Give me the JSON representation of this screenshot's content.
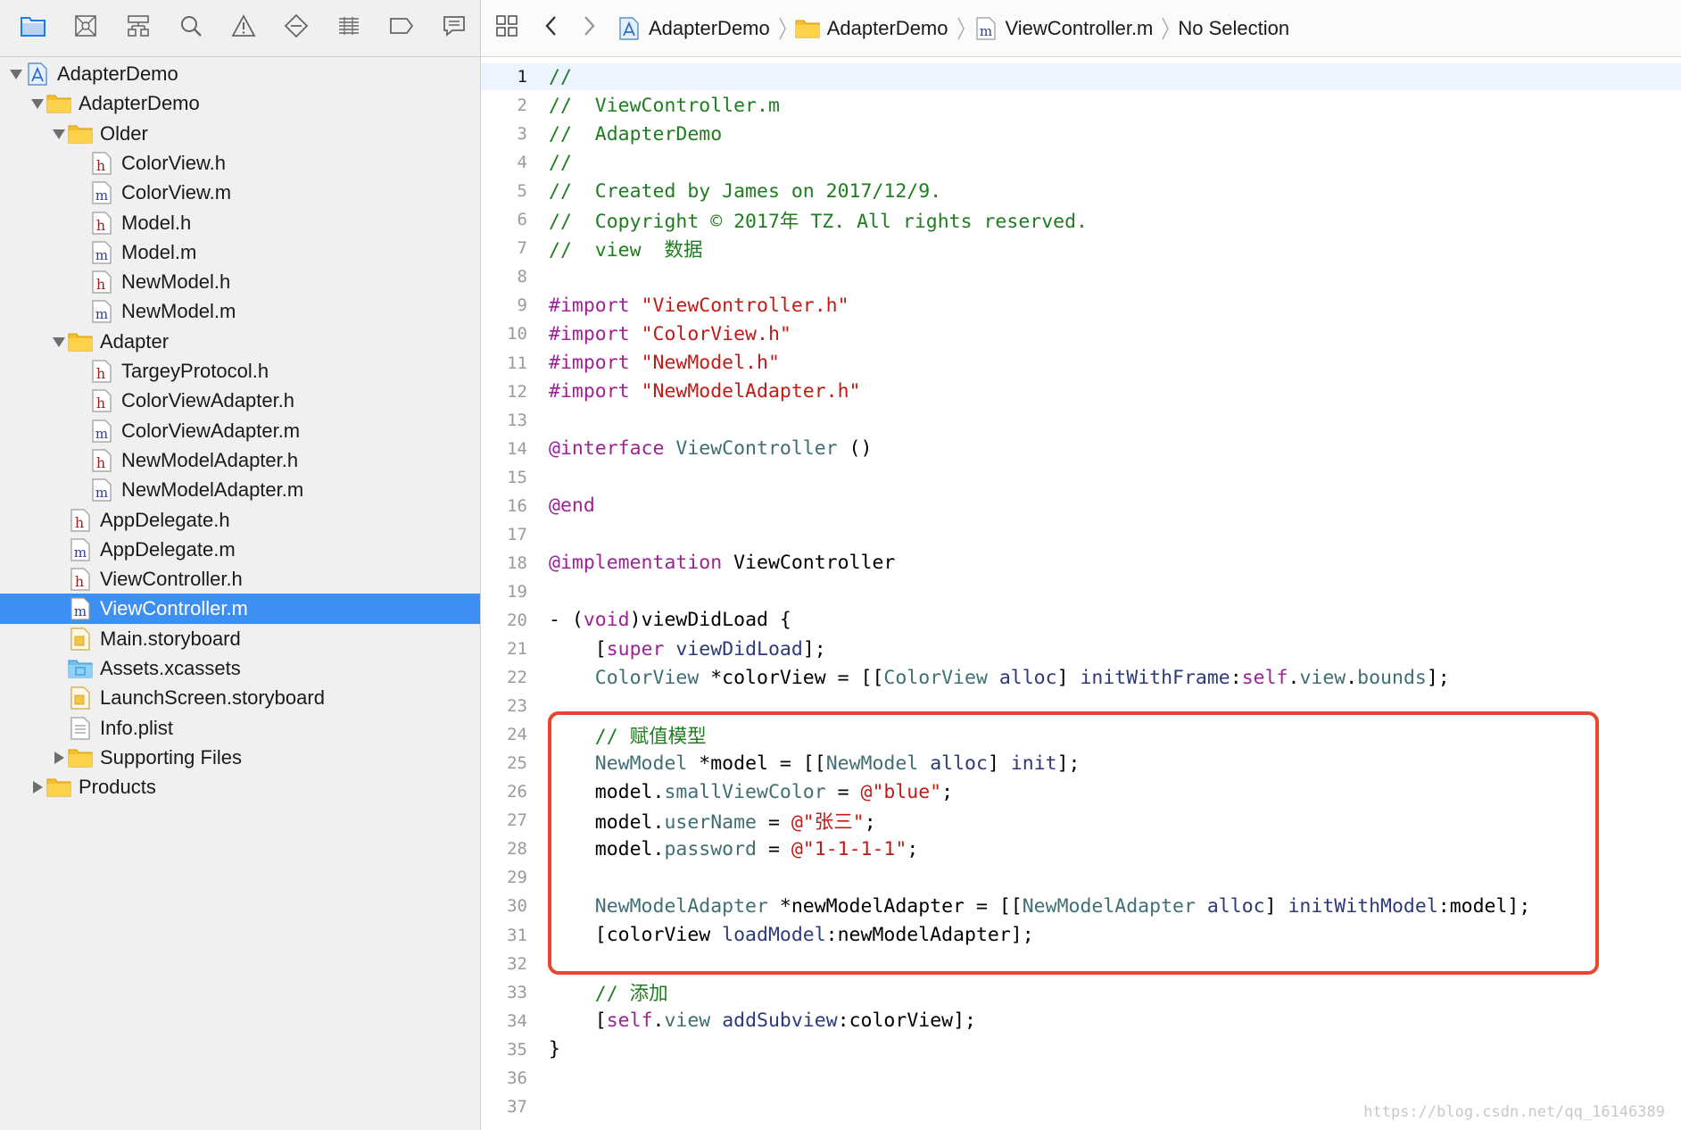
{
  "colors": {
    "selection": "#3d8ff1",
    "highlight_box": "#e8472e",
    "comment": "#1f7d1f",
    "keyword": "#9b2393",
    "string": "#c41a16",
    "type": "#3f6e74",
    "method": "#2c3a7a"
  },
  "navigator_toolbar": [
    {
      "name": "project-navigator-icon",
      "active": true
    },
    {
      "name": "source-control-navigator-icon",
      "active": false
    },
    {
      "name": "symbol-navigator-icon",
      "active": false
    },
    {
      "name": "find-navigator-icon",
      "active": false
    },
    {
      "name": "issue-navigator-icon",
      "active": false
    },
    {
      "name": "test-navigator-icon",
      "active": false
    },
    {
      "name": "debug-navigator-icon",
      "active": false
    },
    {
      "name": "breakpoint-navigator-icon",
      "active": false
    },
    {
      "name": "report-navigator-icon",
      "active": false
    }
  ],
  "tree": [
    {
      "label": "AdapterDemo",
      "depth": 0,
      "icon": "project-icon",
      "disclosure": "open"
    },
    {
      "label": "AdapterDemo",
      "depth": 1,
      "icon": "folder-icon",
      "disclosure": "open"
    },
    {
      "label": "Older",
      "depth": 2,
      "icon": "folder-icon",
      "disclosure": "open"
    },
    {
      "label": "ColorView.h",
      "depth": 3,
      "icon": "h-file-icon",
      "disclosure": "none"
    },
    {
      "label": "ColorView.m",
      "depth": 3,
      "icon": "m-file-icon",
      "disclosure": "none"
    },
    {
      "label": "Model.h",
      "depth": 3,
      "icon": "h-file-icon",
      "disclosure": "none"
    },
    {
      "label": "Model.m",
      "depth": 3,
      "icon": "m-file-icon",
      "disclosure": "none"
    },
    {
      "label": "NewModel.h",
      "depth": 3,
      "icon": "h-file-icon",
      "disclosure": "none"
    },
    {
      "label": "NewModel.m",
      "depth": 3,
      "icon": "m-file-icon",
      "disclosure": "none"
    },
    {
      "label": "Adapter",
      "depth": 2,
      "icon": "folder-icon",
      "disclosure": "open"
    },
    {
      "label": "TargeyProtocol.h",
      "depth": 3,
      "icon": "h-file-icon",
      "disclosure": "none"
    },
    {
      "label": "ColorViewAdapter.h",
      "depth": 3,
      "icon": "h-file-icon",
      "disclosure": "none"
    },
    {
      "label": "ColorViewAdapter.m",
      "depth": 3,
      "icon": "m-file-icon",
      "disclosure": "none"
    },
    {
      "label": "NewModelAdapter.h",
      "depth": 3,
      "icon": "h-file-icon",
      "disclosure": "none"
    },
    {
      "label": "NewModelAdapter.m",
      "depth": 3,
      "icon": "m-file-icon",
      "disclosure": "none"
    },
    {
      "label": "AppDelegate.h",
      "depth": 2,
      "icon": "h-file-icon",
      "disclosure": "none"
    },
    {
      "label": "AppDelegate.m",
      "depth": 2,
      "icon": "m-file-icon",
      "disclosure": "none"
    },
    {
      "label": "ViewController.h",
      "depth": 2,
      "icon": "h-file-icon",
      "disclosure": "none"
    },
    {
      "label": "ViewController.m",
      "depth": 2,
      "icon": "m-file-icon",
      "disclosure": "none",
      "selected": true
    },
    {
      "label": "Main.storyboard",
      "depth": 2,
      "icon": "storyboard-icon",
      "disclosure": "none"
    },
    {
      "label": "Assets.xcassets",
      "depth": 2,
      "icon": "assets-folder-icon",
      "disclosure": "none"
    },
    {
      "label": "LaunchScreen.storyboard",
      "depth": 2,
      "icon": "storyboard-icon",
      "disclosure": "none"
    },
    {
      "label": "Info.plist",
      "depth": 2,
      "icon": "plist-icon",
      "disclosure": "none"
    },
    {
      "label": "Supporting Files",
      "depth": 2,
      "icon": "folder-icon",
      "disclosure": "closed"
    },
    {
      "label": "Products",
      "depth": 1,
      "icon": "folder-icon",
      "disclosure": "closed"
    }
  ],
  "jumpbar": {
    "crumbs": [
      {
        "label": "AdapterDemo",
        "icon": "project-icon"
      },
      {
        "label": "AdapterDemo",
        "icon": "folder-icon"
      },
      {
        "label": "ViewController.m",
        "icon": "m-file-icon"
      },
      {
        "label": "No Selection",
        "icon": ""
      }
    ]
  },
  "code_lines": [
    {
      "n": "1",
      "current": true,
      "tokens": [
        [
          "c",
          "//"
        ]
      ]
    },
    {
      "n": "2",
      "tokens": [
        [
          "c",
          "//  ViewController.m"
        ]
      ]
    },
    {
      "n": "3",
      "tokens": [
        [
          "c",
          "//  AdapterDemo"
        ]
      ]
    },
    {
      "n": "4",
      "tokens": [
        [
          "c",
          "//"
        ]
      ]
    },
    {
      "n": "5",
      "tokens": [
        [
          "c",
          "//  Created by James on 2017/12/9."
        ]
      ]
    },
    {
      "n": "6",
      "tokens": [
        [
          "c",
          "//  Copyright © 2017年 TZ. All rights reserved."
        ]
      ]
    },
    {
      "n": "7",
      "tokens": [
        [
          "c",
          "//  view  数据"
        ]
      ]
    },
    {
      "n": "8",
      "tokens": []
    },
    {
      "n": "9",
      "tokens": [
        [
          "k",
          "#import "
        ],
        [
          "s",
          "\"ViewController.h\""
        ]
      ]
    },
    {
      "n": "10",
      "tokens": [
        [
          "k",
          "#import "
        ],
        [
          "s",
          "\"ColorView.h\""
        ]
      ]
    },
    {
      "n": "11",
      "tokens": [
        [
          "k",
          "#import "
        ],
        [
          "s",
          "\"NewModel.h\""
        ]
      ]
    },
    {
      "n": "12",
      "tokens": [
        [
          "k",
          "#import "
        ],
        [
          "s",
          "\"NewModelAdapter.h\""
        ]
      ]
    },
    {
      "n": "13",
      "tokens": []
    },
    {
      "n": "14",
      "tokens": [
        [
          "k",
          "@interface "
        ],
        [
          "t",
          "ViewController"
        ],
        [
          "p",
          " ()"
        ]
      ]
    },
    {
      "n": "15",
      "tokens": []
    },
    {
      "n": "16",
      "tokens": [
        [
          "k",
          "@end"
        ]
      ]
    },
    {
      "n": "17",
      "tokens": []
    },
    {
      "n": "18",
      "tokens": [
        [
          "k",
          "@implementation "
        ],
        [
          "p",
          "ViewController"
        ]
      ]
    },
    {
      "n": "19",
      "tokens": []
    },
    {
      "n": "20",
      "tokens": [
        [
          "p",
          "- ("
        ],
        [
          "k",
          "void"
        ],
        [
          "p",
          ")viewDidLoad {"
        ]
      ]
    },
    {
      "n": "21",
      "tokens": [
        [
          "p",
          "    ["
        ],
        [
          "k",
          "super"
        ],
        [
          "p",
          " "
        ],
        [
          "m",
          "viewDidLoad"
        ],
        [
          "p",
          "];"
        ]
      ]
    },
    {
      "n": "22",
      "tokens": [
        [
          "p",
          "    "
        ],
        [
          "t",
          "ColorView"
        ],
        [
          "p",
          " *colorView = [["
        ],
        [
          "t",
          "ColorView"
        ],
        [
          "p",
          " "
        ],
        [
          "m",
          "alloc"
        ],
        [
          "p",
          "] "
        ],
        [
          "m",
          "initWithFrame"
        ],
        [
          "p",
          ":"
        ],
        [
          "k",
          "self"
        ],
        [
          "p",
          "."
        ],
        [
          "r",
          "view"
        ],
        [
          "p",
          "."
        ],
        [
          "r",
          "bounds"
        ],
        [
          "p",
          "];"
        ]
      ]
    },
    {
      "n": "23",
      "tokens": []
    },
    {
      "n": "24",
      "tokens": [
        [
          "p",
          "    "
        ],
        [
          "c",
          "// 赋值模型"
        ]
      ]
    },
    {
      "n": "25",
      "tokens": [
        [
          "p",
          "    "
        ],
        [
          "t",
          "NewModel"
        ],
        [
          "p",
          " *model = [["
        ],
        [
          "t",
          "NewModel"
        ],
        [
          "p",
          " "
        ],
        [
          "m",
          "alloc"
        ],
        [
          "p",
          "] "
        ],
        [
          "m",
          "init"
        ],
        [
          "p",
          "];"
        ]
      ]
    },
    {
      "n": "26",
      "tokens": [
        [
          "p",
          "    model."
        ],
        [
          "r",
          "smallViewColor"
        ],
        [
          "p",
          " = "
        ],
        [
          "s",
          "@\"blue\""
        ],
        [
          "p",
          ";"
        ]
      ]
    },
    {
      "n": "27",
      "tokens": [
        [
          "p",
          "    model."
        ],
        [
          "r",
          "userName"
        ],
        [
          "p",
          " = "
        ],
        [
          "s",
          "@\"张三\""
        ],
        [
          "p",
          ";"
        ]
      ]
    },
    {
      "n": "28",
      "tokens": [
        [
          "p",
          "    model."
        ],
        [
          "r",
          "password"
        ],
        [
          "p",
          " = "
        ],
        [
          "s",
          "@\"1-1-1-1\""
        ],
        [
          "p",
          ";"
        ]
      ]
    },
    {
      "n": "29",
      "tokens": []
    },
    {
      "n": "30",
      "tokens": [
        [
          "p",
          "    "
        ],
        [
          "t",
          "NewModelAdapter"
        ],
        [
          "p",
          " *newModelAdapter = [["
        ],
        [
          "t",
          "NewModelAdapter"
        ],
        [
          "p",
          " "
        ],
        [
          "m",
          "alloc"
        ],
        [
          "p",
          "] "
        ],
        [
          "m",
          "initWithModel"
        ],
        [
          "p",
          ":model];"
        ]
      ]
    },
    {
      "n": "31",
      "tokens": [
        [
          "p",
          "    [colorView "
        ],
        [
          "m",
          "loadModel"
        ],
        [
          "p",
          ":newModelAdapter];"
        ]
      ]
    },
    {
      "n": "32",
      "tokens": []
    },
    {
      "n": "33",
      "tokens": [
        [
          "p",
          "    "
        ],
        [
          "c",
          "// 添加"
        ]
      ]
    },
    {
      "n": "34",
      "tokens": [
        [
          "p",
          "    ["
        ],
        [
          "k",
          "self"
        ],
        [
          "p",
          "."
        ],
        [
          "r",
          "view"
        ],
        [
          "p",
          " "
        ],
        [
          "m",
          "addSubview"
        ],
        [
          "p",
          ":colorView];"
        ]
      ]
    },
    {
      "n": "35",
      "tokens": [
        [
          "p",
          "}"
        ]
      ]
    },
    {
      "n": "36",
      "tokens": []
    },
    {
      "n": "37",
      "tokens": []
    }
  ],
  "watermark": "https://blog.csdn.net/qq_16146389"
}
